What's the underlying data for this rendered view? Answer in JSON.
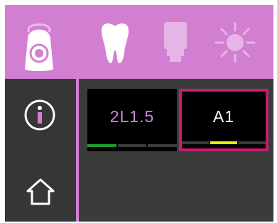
{
  "colors": {
    "accent": "#d27fd2",
    "background": "#3b3b3b",
    "selection_border": "#c81c72",
    "tile_background": "#000000",
    "level_green": "#1f9a2c",
    "level_yellow": "#f2ea00"
  },
  "top_bar": {
    "icons": [
      "scanner-device-icon",
      "tooth-icon",
      "shade-tab-icon",
      "light-sun-icon"
    ]
  },
  "sidebar": {
    "items": [
      {
        "icon": "info-icon"
      },
      {
        "icon": "home-icon"
      }
    ]
  },
  "shades": [
    {
      "label": "2L1.5",
      "selected": false,
      "indicator_color": "#1f9a2c"
    },
    {
      "label": "A1",
      "selected": true,
      "indicator_color": "#f2ea00"
    }
  ]
}
